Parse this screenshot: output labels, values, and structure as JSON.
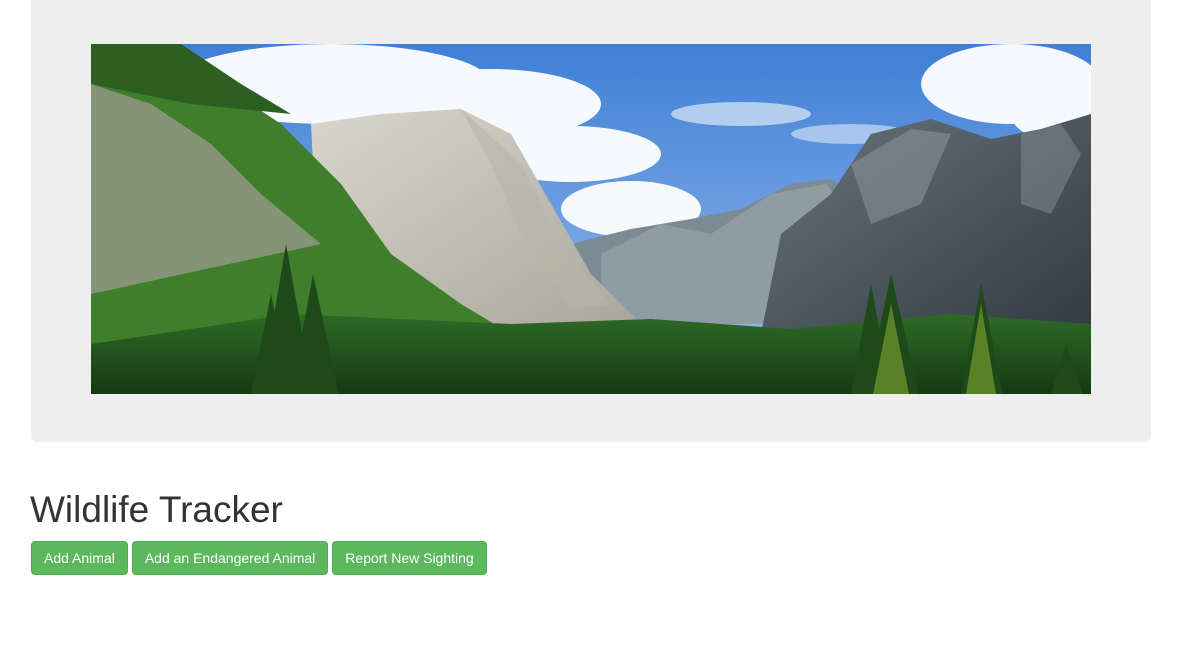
{
  "hero": {
    "image_icon": "yosemite-valley-landscape-photo",
    "colors": {
      "sky_top": "#3f7fd6",
      "sky_bottom": "#8fb8ea",
      "cloud": "#ffffff",
      "cliff_light": "#c9c6bd",
      "cliff_dark": "#4a5560",
      "forest_light": "#3f8a2a",
      "forest_dark": "#1f4a1c"
    }
  },
  "page_title": "Wildlife Tracker",
  "buttons": [
    {
      "label": "Add Animal"
    },
    {
      "label": "Add an Endangered Animal"
    },
    {
      "label": "Report New Sighting"
    }
  ],
  "theme": {
    "jumbotron_bg": "#eeeeee",
    "button_bg": "#5cb85c",
    "button_border": "#4cae4c",
    "button_text": "#ffffff",
    "title_color": "#333333"
  }
}
